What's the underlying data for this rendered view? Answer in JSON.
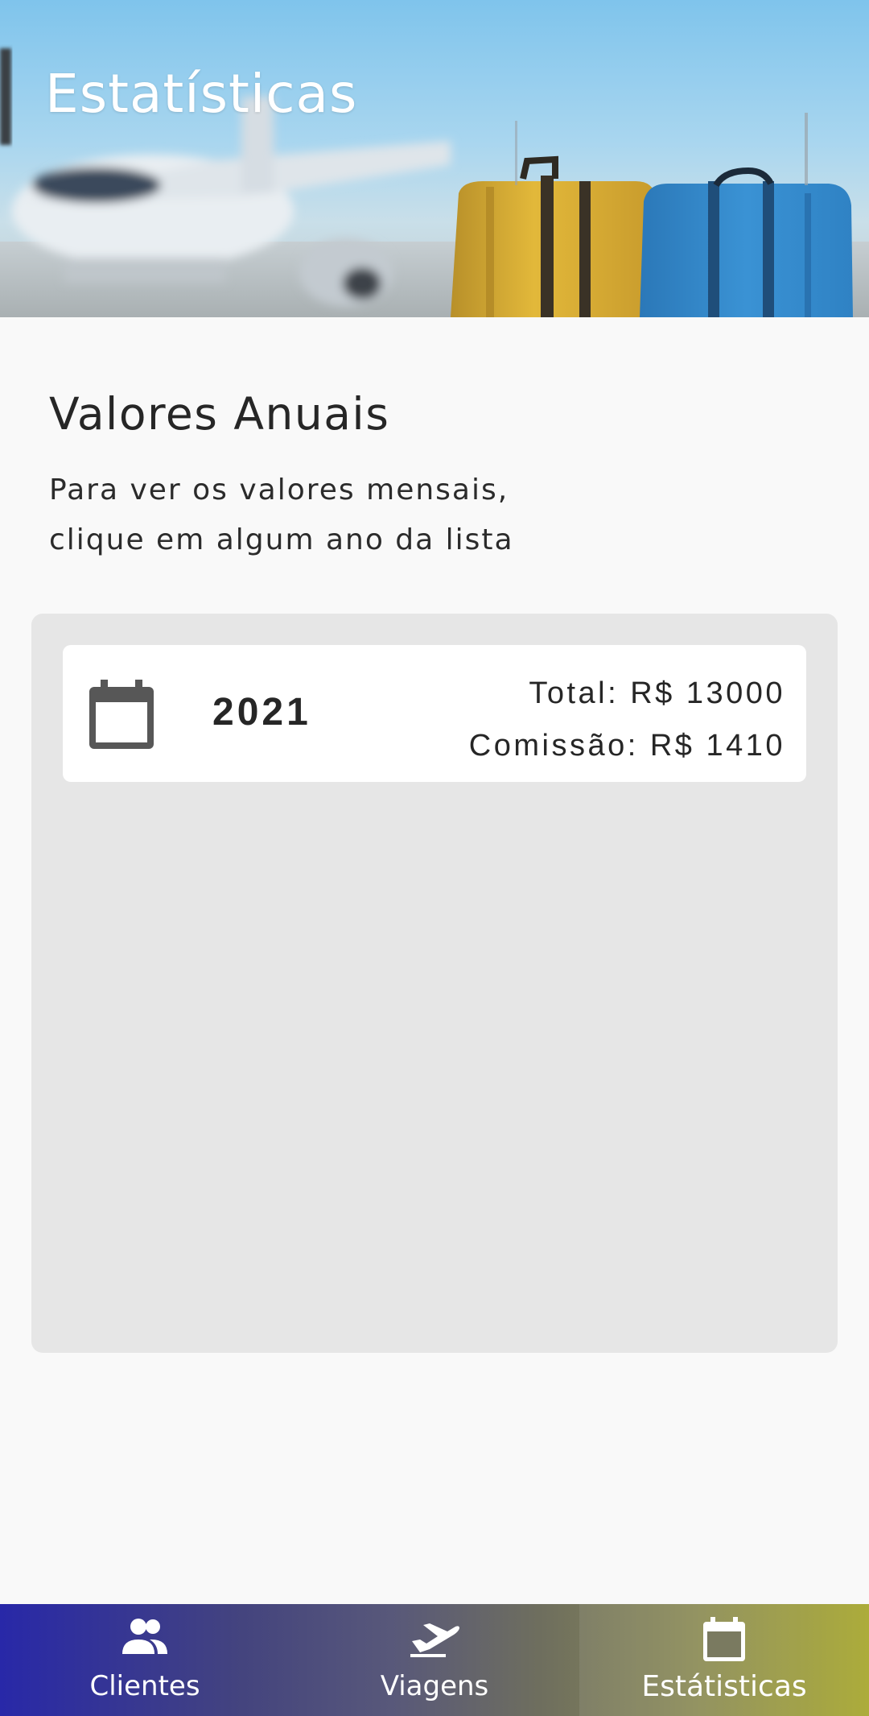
{
  "header": {
    "title": "Estatísticas"
  },
  "intro": {
    "title": "Valores Anuais",
    "description_line1": "Para ver os valores mensais,",
    "description_line2": "clique em algum ano da lista"
  },
  "years": [
    {
      "year": "2021",
      "total": "Total: R$ 13000",
      "commission": "Comissão: R$ 1410",
      "icon": "calendar-icon"
    }
  ],
  "nav": {
    "items": [
      {
        "label": "Clientes",
        "icon": "people-icon",
        "active": false
      },
      {
        "label": "Viagens",
        "icon": "airplane-icon",
        "active": false
      },
      {
        "label": "Estátisticas",
        "icon": "calendar-icon",
        "active": true
      }
    ]
  },
  "colors": {
    "nav_start": "#2828a8",
    "nav_end": "#a5a52a",
    "panel_bg": "#e6e6e6",
    "icon_gray": "#575757"
  }
}
